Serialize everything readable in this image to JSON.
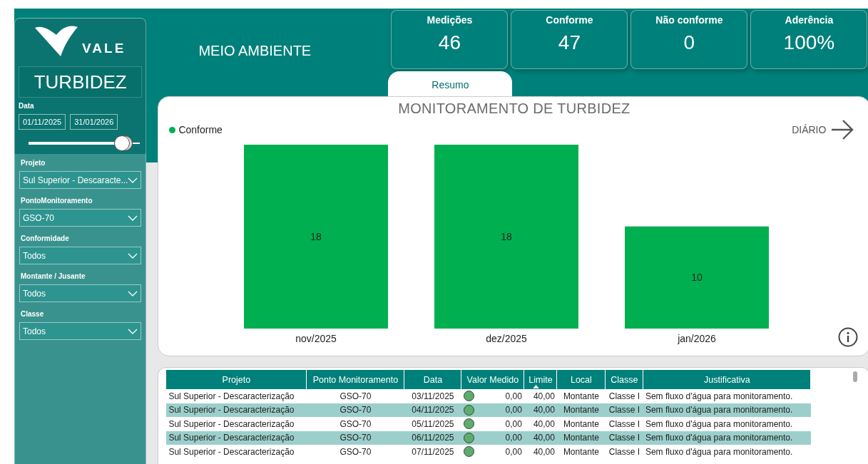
{
  "sidebar": {
    "logo_text": "VALE",
    "title": "TURBIDEZ",
    "date_filter": {
      "label": "Data",
      "start": "01/11/2025",
      "end": "31/01/2026",
      "level": 0.87
    },
    "filters": [
      {
        "label": "Projeto",
        "value": "Sul Superior - Descaracte..."
      },
      {
        "label": "PontoMonitoramento",
        "value": "GSO-70"
      },
      {
        "label": "Conformidade",
        "value": "Todos"
      },
      {
        "label": "Montante / Jusante",
        "value": "Todos"
      },
      {
        "label": "Classe",
        "value": "Todos"
      }
    ]
  },
  "header": {
    "title": "MEIO AMBIENTE"
  },
  "kpis": [
    {
      "label": "Medições",
      "value": "46"
    },
    {
      "label": "Conforme",
      "value": "47"
    },
    {
      "label": "Não conforme",
      "value": "0"
    },
    {
      "label": "Aderência",
      "value": "100%"
    }
  ],
  "tabs": [
    {
      "label": "Resumo",
      "selected": true
    }
  ],
  "chart": {
    "nav_label": "DIÁRIO",
    "chart_data": {
      "type": "bar",
      "title": "MONITORAMENTO DE TURBIDEZ",
      "categories": [
        "nov/2025",
        "dez/2025",
        "jan/2026"
      ],
      "series": [
        {
          "name": "Conforme",
          "color": "#00b050",
          "values": [
            18,
            18,
            10
          ]
        }
      ],
      "data_labels": true
    }
  },
  "table": {
    "columns": [
      "Projeto",
      "Ponto Monitoramento",
      "Data",
      "Valor Medido",
      "Limite",
      "Local",
      "Classe",
      "Justificativa"
    ],
    "rows": [
      {
        "cells": [
          "Sul Superior - Descaracterização",
          "GSO-70",
          "03/11/2025",
          "0,00",
          "40,00",
          "Montante",
          "Classe I",
          "Sem fluxo d'água para monitoramento."
        ],
        "color": "#5fab6e"
      },
      {
        "cells": [
          "Sul Superior - Descaracterização",
          "GSO-70",
          "04/11/2025",
          "0,00",
          "40,00",
          "Montante",
          "Classe I",
          "Sem fluxo d'água para monitoramento."
        ],
        "color": "#5fab6e"
      },
      {
        "cells": [
          "Sul Superior - Descaracterização",
          "GSO-70",
          "05/11/2025",
          "0,00",
          "40,00",
          "Montante",
          "Classe I",
          "Sem fluxo d'água para monitoramento."
        ],
        "color": "#5fab6e"
      },
      {
        "cells": [
          "Sul Superior - Descaracterização",
          "GSO-70",
          "06/11/2025",
          "0,00",
          "40,00",
          "Montante",
          "Classe I",
          "Sem fluxo d'água para monitoramento."
        ],
        "color": "#5fab6e"
      },
      {
        "cells": [
          "Sul Superior - Descaracterização",
          "GSO-70",
          "07/11/2025",
          "0,00",
          "40,00",
          "Montante",
          "Classe I",
          "Sem fluxo d'água para monitoramento."
        ],
        "color": "#5fab6e"
      }
    ]
  }
}
